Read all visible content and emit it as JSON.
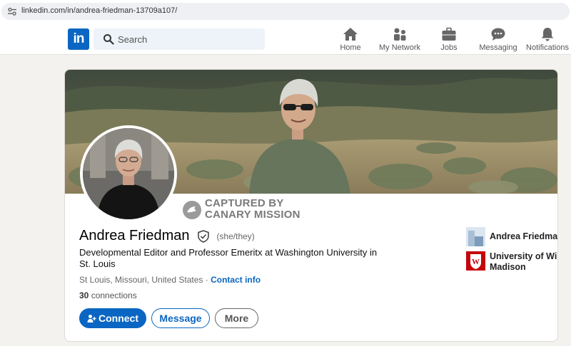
{
  "browser": {
    "url": "linkedin.com/in/andrea-friedman-13709a107/"
  },
  "nav": {
    "logo": "in",
    "search_placeholder": "Search",
    "items": [
      {
        "label": "Home",
        "icon": "home-icon"
      },
      {
        "label": "My Network",
        "icon": "network-icon"
      },
      {
        "label": "Jobs",
        "icon": "briefcase-icon"
      },
      {
        "label": "Messaging",
        "icon": "chat-icon"
      },
      {
        "label": "Notifications",
        "icon": "bell-icon"
      }
    ]
  },
  "watermark": {
    "line1": "CAPTURED BY",
    "line2": "CANARY MISSION"
  },
  "profile": {
    "name": "Andrea Friedman",
    "pronouns": "(she/they)",
    "headline": "Developmental Editor and Professor Emeritx at Washington University in St. Louis",
    "location": "St Louis, Missouri, United States",
    "separator": " · ",
    "contact_info": "Contact info",
    "connections_count": "30",
    "connections_label": " connections"
  },
  "actions": {
    "connect": "Connect",
    "message": "Message",
    "more": "More"
  },
  "organizations": [
    {
      "name": "Andrea Friedman Editing"
    },
    {
      "name_line1": "University of Wisconsin-",
      "name_line2": "Madison",
      "logo_letter": "W"
    }
  ],
  "colors": {
    "brand": "#0a66c2",
    "wisconsin": "#c5050c"
  }
}
